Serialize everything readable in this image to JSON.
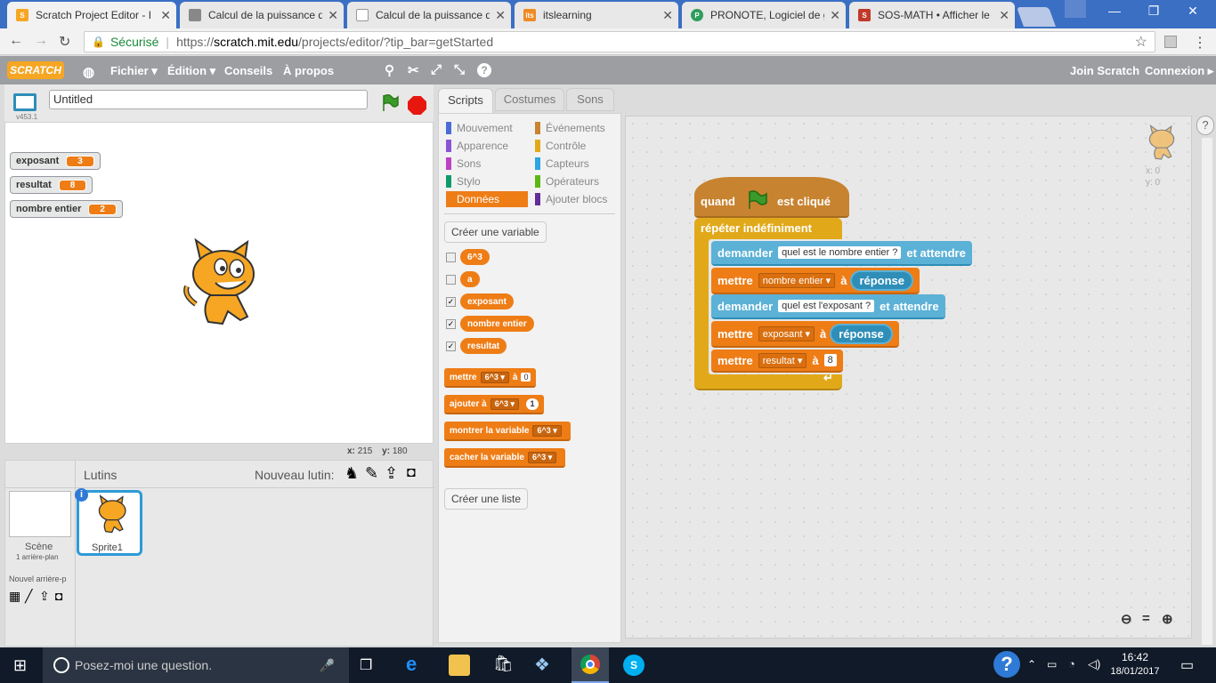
{
  "browser": {
    "tabs": [
      {
        "title": "Scratch Project Editor - I",
        "icon": "scratch-favicon",
        "color": "#f6a623"
      },
      {
        "title": "Calcul de la puissance d",
        "icon": "page-favicon",
        "color": "#888888"
      },
      {
        "title": "Calcul de la puissance d",
        "icon": "doc-favicon",
        "color": "#aaaaaa"
      },
      {
        "title": "itslearning",
        "icon": "its-favicon",
        "color": "#f08a24"
      },
      {
        "title": "PRONOTE, Logiciel de g",
        "icon": "pronote-favicon",
        "color": "#2e9e5b"
      },
      {
        "title": "SOS-MATH • Afficher le",
        "icon": "sosmath-favicon",
        "color": "#c0392b"
      }
    ],
    "secure_label": "Sécurisé",
    "url": "https://scratch.mit.edu/projects/editor/?tip_bar=getStarted",
    "url_prefix": "https://",
    "url_domain": "scratch.mit.edu",
    "url_path": "/projects/editor/?tip_bar=getStarted"
  },
  "menubar": {
    "logo": "SCRATCH",
    "items": [
      "Fichier ▾",
      "Édition ▾",
      "Conseils",
      "À propos"
    ],
    "join": "Join Scratch",
    "login": "Connexion ▸"
  },
  "stage": {
    "project_title": "Untitled",
    "version": "v453.1",
    "coords_x_label": "x:",
    "coords_x": "215",
    "coords_y_label": "y:",
    "coords_y": "180",
    "monitors": [
      {
        "name": "exposant",
        "value": "3"
      },
      {
        "name": "resultat",
        "value": "8"
      },
      {
        "name": "nombre entier",
        "value": "2"
      }
    ]
  },
  "sprites": {
    "header": "Lutins",
    "new_sprite_label": "Nouveau lutin:",
    "scene_label": "Scène",
    "scene_sub": "1 arrière-plan",
    "new_backdrop_label": "Nouvel arrière-p",
    "sprite_name": "Sprite1"
  },
  "editor": {
    "tabs": [
      "Scripts",
      "Costumes",
      "Sons"
    ],
    "categories_left": [
      {
        "label": "Mouvement",
        "color": "#4a6cd4"
      },
      {
        "label": "Apparence",
        "color": "#8a55d7"
      },
      {
        "label": "Sons",
        "color": "#bb42c3"
      },
      {
        "label": "Stylo",
        "color": "#0e9a6c"
      },
      {
        "label": "Données",
        "color": "#ee7d16"
      }
    ],
    "categories_right": [
      {
        "label": "Événements",
        "color": "#c88330"
      },
      {
        "label": "Contrôle",
        "color": "#e1a91a"
      },
      {
        "label": "Capteurs",
        "color": "#2ca5e2"
      },
      {
        "label": "Opérateurs",
        "color": "#5cb712"
      },
      {
        "label": "Ajouter blocs",
        "color": "#632d99"
      }
    ],
    "create_variable": "Créer une variable",
    "create_list": "Créer une liste",
    "variables": [
      {
        "name": "6^3",
        "checked": false
      },
      {
        "name": "a",
        "checked": false
      },
      {
        "name": "exposant",
        "checked": true
      },
      {
        "name": "nombre entier",
        "checked": true
      },
      {
        "name": "resultat",
        "checked": true
      }
    ],
    "palette_blocks": {
      "set": {
        "label": "mettre",
        "var": "6^3",
        "to": "à",
        "value": "0"
      },
      "change": {
        "label": "ajouter à",
        "var": "6^3",
        "value": "1"
      },
      "show": {
        "label": "montrer la variable",
        "var": "6^3"
      },
      "hide": {
        "label": "cacher la variable",
        "var": "6^3"
      }
    },
    "sprite_coords": {
      "x": "x: 0",
      "y": "y: 0"
    }
  },
  "script": {
    "hat": {
      "pre": "quand",
      "post": "est cliqué"
    },
    "forever": "répéter indéfiniment",
    "ask1": {
      "label": "demander",
      "question": "quel est le nombre entier ?",
      "wait": "et attendre"
    },
    "set1": {
      "label": "mettre",
      "var": "nombre entier",
      "to": "à",
      "reporter": "réponse"
    },
    "ask2": {
      "label": "demander",
      "question": "quel est l'exposant ?",
      "wait": "et attendre"
    },
    "set2": {
      "label": "mettre",
      "var": "exposant",
      "to": "à",
      "reporter": "réponse"
    },
    "set3": {
      "label": "mettre",
      "var": "resultat",
      "to": "à",
      "value": "8"
    }
  },
  "taskbar": {
    "search_placeholder": "Posez-moi une question.",
    "time": "16:42",
    "date": "18/01/2017"
  },
  "colors": {
    "data_orange": "#ee7d16",
    "sensing_blue": "#5cb1d6",
    "control_gold": "#e1a91a",
    "chrome_blue": "#3a6fc4",
    "scratch_gray": "#9c9ea2"
  }
}
